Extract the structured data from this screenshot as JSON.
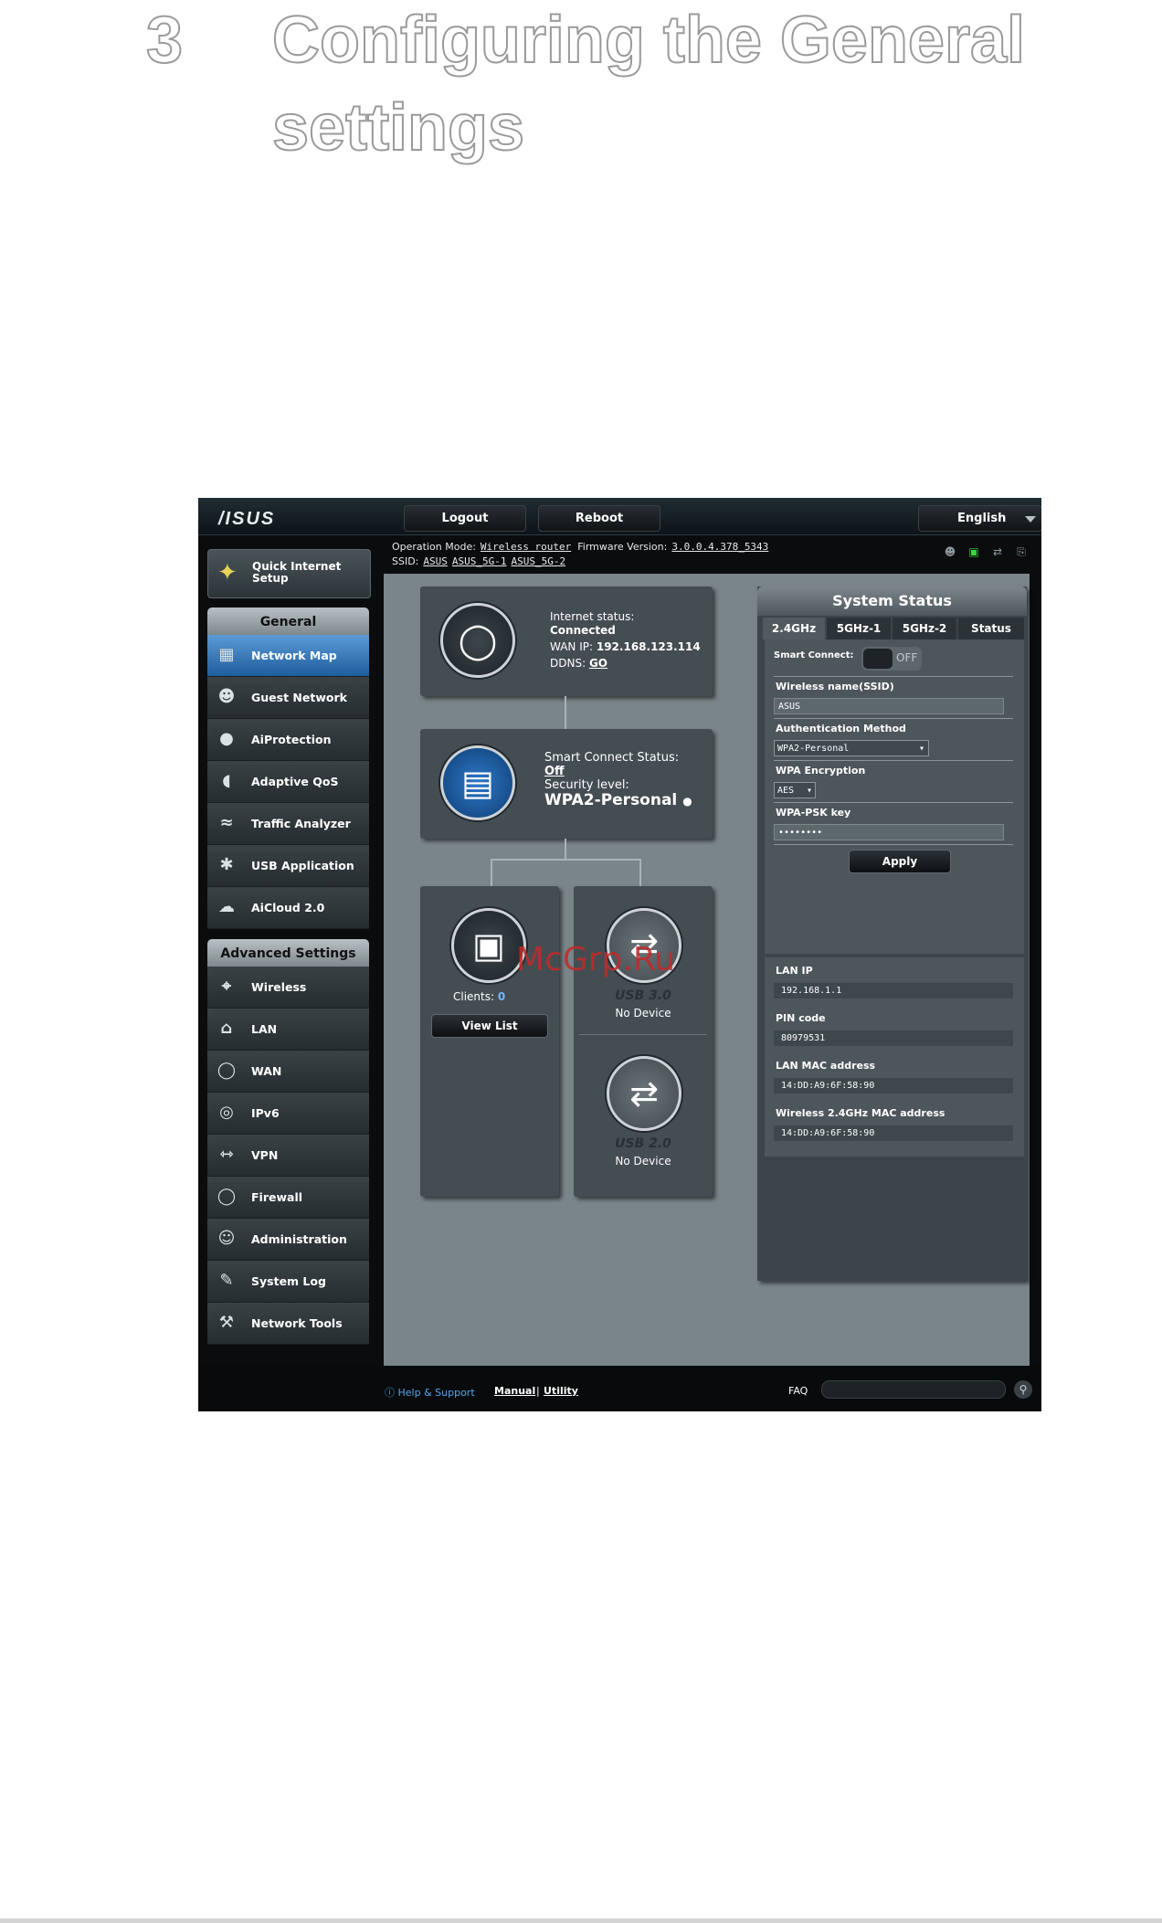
{
  "chapter": {
    "number": "3",
    "title": "Configuring the General settings"
  },
  "router": {
    "logo": "/ISUS",
    "top_buttons": {
      "logout": "Logout",
      "reboot": "Reboot",
      "language": "English"
    },
    "info": {
      "op_mode_label": "Operation Mode:",
      "op_mode_value": "Wireless router",
      "firmware_label": "Firmware Version:",
      "firmware_value": "3.0.0.4.378_5343",
      "ssid_label": "SSID:",
      "ssids": [
        "ASUS",
        "ASUS_5G-1",
        "ASUS_5G-2"
      ]
    },
    "status_icons": [
      "users-icon",
      "network-icon",
      "usb-icon",
      "printer-icon"
    ],
    "sidebar": {
      "qis_label": "Quick Internet Setup",
      "general_header": "General",
      "general_items": [
        {
          "label": "Network Map",
          "icon": "network-map-icon",
          "active": true
        },
        {
          "label": "Guest Network",
          "icon": "guest-network-icon"
        },
        {
          "label": "AiProtection",
          "icon": "lock-icon"
        },
        {
          "label": "Adaptive QoS",
          "icon": "gauge-icon"
        },
        {
          "label": "Traffic Analyzer",
          "icon": "traffic-icon"
        },
        {
          "label": "USB Application",
          "icon": "puzzle-icon"
        },
        {
          "label": "AiCloud 2.0",
          "icon": "cloud-icon"
        }
      ],
      "advanced_header": "Advanced Settings",
      "advanced_items": [
        {
          "label": "Wireless",
          "icon": "wifi-icon"
        },
        {
          "label": "LAN",
          "icon": "home-icon"
        },
        {
          "label": "WAN",
          "icon": "globe-icon"
        },
        {
          "label": "IPv6",
          "icon": "ipv6-icon"
        },
        {
          "label": "VPN",
          "icon": "vpn-icon"
        },
        {
          "label": "Firewall",
          "icon": "shield-icon"
        },
        {
          "label": "Administration",
          "icon": "admin-icon"
        },
        {
          "label": "System Log",
          "icon": "log-icon"
        },
        {
          "label": "Network Tools",
          "icon": "tools-icon"
        }
      ]
    },
    "network_map": {
      "internet_status_label": "Internet status:",
      "internet_status_value": "Connected",
      "wan_ip_label": "WAN IP:",
      "wan_ip_value": "192.168.123.114",
      "ddns_label": "DDNS:",
      "ddns_value": "GO",
      "smart_connect_label": "Smart Connect Status:",
      "smart_connect_value": "Off",
      "security_label": "Security level:",
      "security_value": "WPA2-Personal",
      "clients_label": "Clients:",
      "clients_value": "0",
      "view_list": "View List",
      "usb30_label": "USB 3.0",
      "usb30_status": "No Device",
      "usb20_label": "USB 2.0",
      "usb20_status": "No Device"
    },
    "system_status": {
      "title": "System Status",
      "tabs": [
        "2.4GHz",
        "5GHz-1",
        "5GHz-2",
        "Status"
      ],
      "smart_connect_label": "Smart Connect:",
      "smart_connect_toggle": "OFF",
      "wireless_name_label": "Wireless name(SSID)",
      "wireless_name_value": "ASUS",
      "auth_method_label": "Authentication Method",
      "auth_method_value": "WPA2-Personal",
      "wpa_encryption_label": "WPA Encryption",
      "wpa_encryption_value": "AES",
      "wpa_psk_label": "WPA-PSK key",
      "wpa_psk_value": "••••••••",
      "apply": "Apply",
      "lan_ip_label": "LAN IP",
      "lan_ip_value": "192.168.1.1",
      "pin_label": "PIN code",
      "pin_value": "80979531",
      "lan_mac_label": "LAN MAC address",
      "lan_mac_value": "14:DD:A9:6F:58:90",
      "wireless_mac_label": "Wireless 2.4GHz MAC address",
      "wireless_mac_value": "14:DD:A9:6F:58:90"
    },
    "footer": {
      "help": "Help & Support",
      "manual": "Manual",
      "separator": "|",
      "utility": "Utility",
      "faq": "FAQ"
    }
  },
  "watermark": "McGrp.Ru"
}
